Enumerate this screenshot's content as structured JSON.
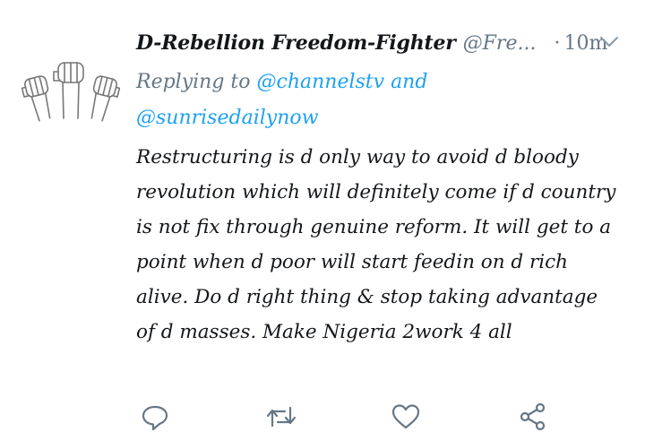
{
  "tweet": {
    "display_name": "D-Rebellion Freedom-Fighter",
    "handle": "@Fre...",
    "separator": "·",
    "time": "10m",
    "reply_prefix": "Replying to",
    "reply_mention_1": "@channelstv",
    "reply_conjunction": "and",
    "reply_mention_2": "@sunrisedailynow",
    "text": "Restructuring is d only way to avoid d bloody revolution which will definitely come if d country is not fix through genuine reform. It will get to a point when d poor will start feedin on d rich alive. Do d right thing & stop taking advantage of d masses. Make Nigeria 2work 4 all"
  },
  "icons": {
    "avatar": "raised-fists-drawing",
    "menu": "chevron-down-icon",
    "reply": "reply-icon",
    "retweet": "retweet-icon",
    "like": "heart-icon",
    "share": "share-icon"
  },
  "colors": {
    "text": "#14171a",
    "muted": "#657786",
    "link": "#1da1f2"
  }
}
